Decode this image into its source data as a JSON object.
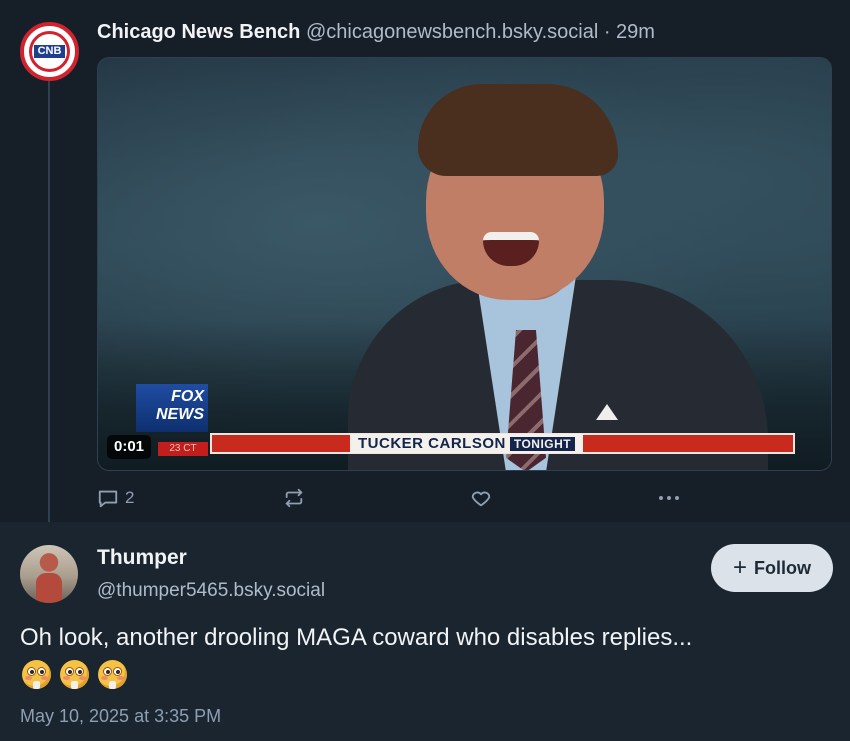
{
  "quoted_post": {
    "avatar_text": "CNB",
    "author_name": "Chicago News Bench",
    "handle": "@chicagonewsbench.bsky.social",
    "separator": " · ",
    "time_ago": "29m",
    "video": {
      "elapsed": "0:01",
      "network_logo": "FOX NEWS",
      "clock": "23 CT",
      "chyron_title": "TUCKER CARLSON",
      "chyron_tag": "TONIGHT"
    },
    "actions": {
      "reply_count": "2",
      "reply_icon": "speech-bubble-icon",
      "repost_icon": "repost-icon",
      "like_icon": "heart-icon",
      "more_icon": "ellipsis-icon"
    }
  },
  "reply_post": {
    "author_name": "Thumper",
    "handle": "@thumper5465.bsky.social",
    "follow_label": "Follow",
    "follow_icon": "+",
    "text": "Oh look, another drooling MAGA coward who disables replies...",
    "emojis": [
      "flushed-face",
      "flushed-face",
      "flushed-face"
    ],
    "date": "May 10, 2025 at 3:35 PM"
  },
  "colors": {
    "background": "#161e27",
    "text": "#f1f3f5",
    "muted": "#aebbc9",
    "thread_line": "#2e4052"
  }
}
